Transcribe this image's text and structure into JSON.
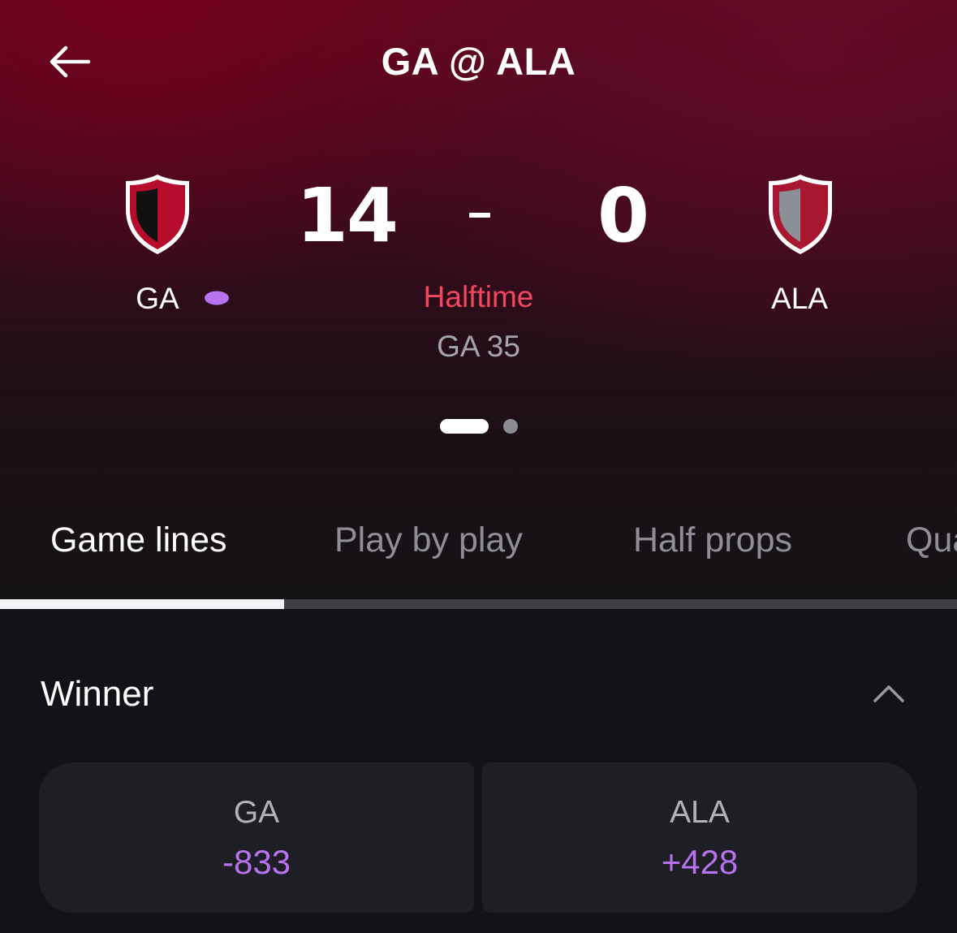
{
  "header": {
    "title": "GA @ ALA",
    "back_icon": "arrow-left-icon"
  },
  "scoreboard": {
    "home": {
      "abbr": "GA",
      "score": "14",
      "colors": {
        "primary": "#b50d2b",
        "secondary": "#111111"
      },
      "has_possession": true
    },
    "away": {
      "abbr": "ALA",
      "score": "0",
      "colors": {
        "primary": "#a8162f",
        "secondary": "#8c8f96"
      }
    },
    "status": "Halftime",
    "clock": "GA 35",
    "possession_icon": "football-icon",
    "pager": {
      "pages": 2,
      "active": 1
    }
  },
  "tabs": [
    {
      "label": "Game lines",
      "active": true
    },
    {
      "label": "Play by play",
      "active": false
    },
    {
      "label": "Half props",
      "active": false
    },
    {
      "label": "Qua",
      "active": false
    }
  ],
  "market": {
    "title": "Winner",
    "collapse_icon": "chevron-up-icon",
    "options": [
      {
        "team": "GA",
        "price": "-833"
      },
      {
        "team": "ALA",
        "price": "+428"
      }
    ]
  },
  "colors": {
    "accent": "#b872f0",
    "status_live": "#f2475f",
    "background": "#121317"
  }
}
